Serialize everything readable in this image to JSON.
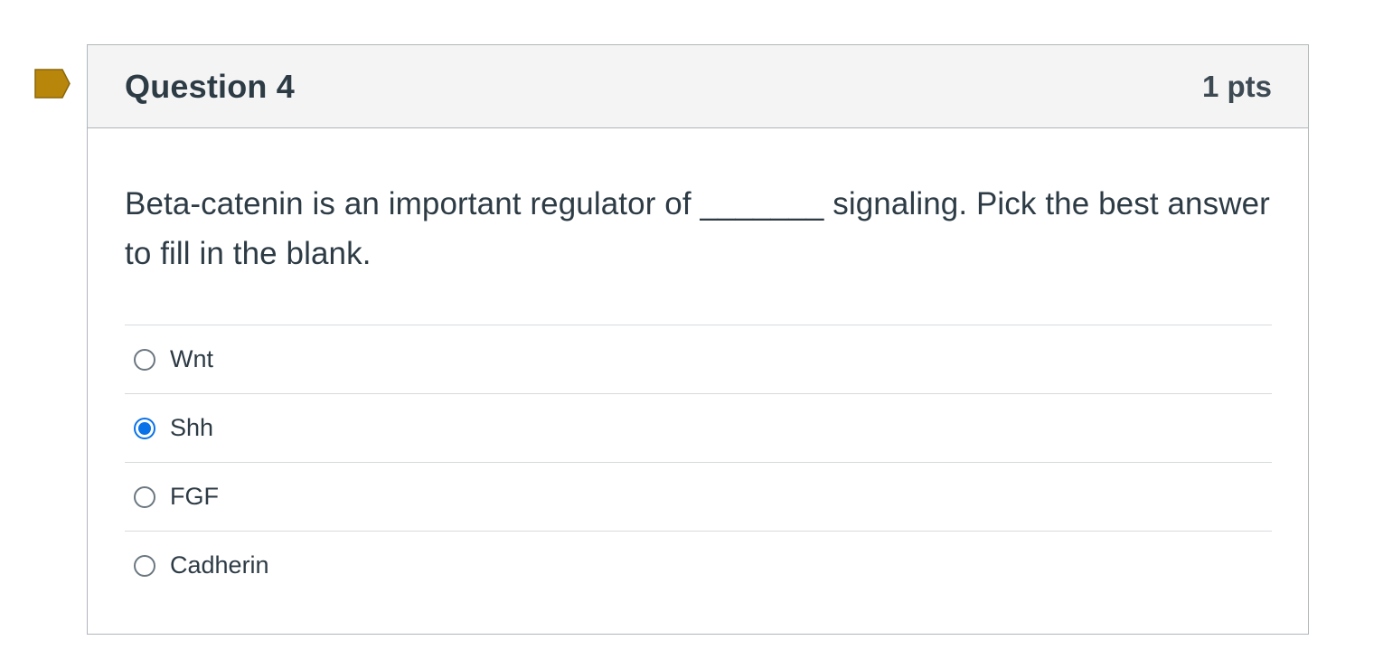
{
  "flag": {
    "icon": "bookmark-flag-icon",
    "color": "#b8860b"
  },
  "question": {
    "title": "Question 4",
    "points": "1 pts",
    "text": "Beta-catenin is an important regulator of _______ signaling. Pick the best answer to fill in the blank.",
    "answers": [
      {
        "label": "Wnt",
        "selected": false
      },
      {
        "label": "Shh",
        "selected": true
      },
      {
        "label": "FGF",
        "selected": false
      },
      {
        "label": "Cadherin",
        "selected": false
      }
    ]
  },
  "colors": {
    "accent": "#0a72e8",
    "text": "#2d3b45",
    "header_bg": "#f4f4f4"
  }
}
